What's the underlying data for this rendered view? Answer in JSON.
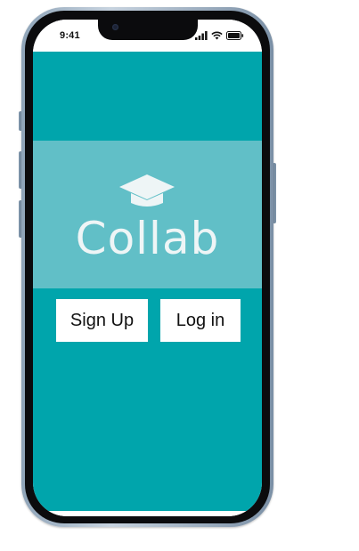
{
  "status_bar": {
    "time": "9:41",
    "icons": [
      "signal-icon",
      "wifi-icon",
      "battery-icon"
    ]
  },
  "app": {
    "logo_icon": "graduation-cap-icon",
    "title": "Collab",
    "signup_label": "Sign Up",
    "login_label": "Log in"
  },
  "colors": {
    "background": "#00a5ac",
    "hero_band": "#8cc9d0",
    "title_text": "#eef5f6",
    "button_bg": "#ffffff",
    "button_text": "#111111"
  }
}
